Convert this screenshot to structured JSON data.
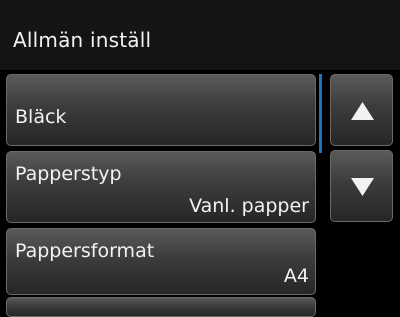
{
  "header": {
    "title": "Allmän inställ"
  },
  "menu": {
    "items": [
      {
        "label": "Bläck",
        "value": ""
      },
      {
        "label": "Papperstyp",
        "value": "Vanl. papper"
      },
      {
        "label": "Pappersformat",
        "value": "A4"
      }
    ]
  },
  "nav": {
    "up_icon": "triangle-up-icon",
    "down_icon": "triangle-down-icon"
  },
  "colors": {
    "accent": "#1d74c7",
    "background": "#000000",
    "header": "#141414",
    "text": "#f2f2f2"
  }
}
